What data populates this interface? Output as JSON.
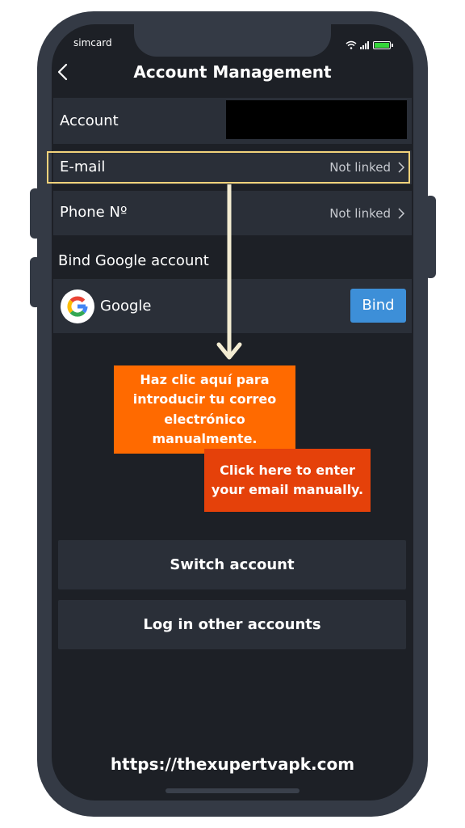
{
  "status_bar": {
    "carrier": "simcard",
    "icons": [
      "wifi-icon",
      "signal-icon",
      "battery-icon"
    ],
    "battery_color": "#35d63a"
  },
  "header": {
    "back_icon": "chevron-left-icon",
    "title": "Account Management"
  },
  "rows": {
    "account": {
      "label": "Account"
    },
    "email": {
      "label": "E-mail",
      "value": "Not linked"
    },
    "phone": {
      "label": "Phone Nº",
      "value": "Not linked"
    }
  },
  "google_section": {
    "title": "Bind Google account",
    "provider": "Google",
    "bind_label": "Bind",
    "bind_color": "#3d8fd8"
  },
  "annotations": {
    "spanish": "Haz clic aquí para introducir tu correo electrónico manualmente.",
    "english": "Click here to enter your email manually.",
    "spanish_color": "#ff6a00",
    "english_color": "#e5410a",
    "highlight_color": "#f2d27a"
  },
  "actions": {
    "switch_account": "Switch account",
    "log_in_other": "Log in other accounts"
  },
  "footer": {
    "website": "https://thexupertvapk.com"
  }
}
